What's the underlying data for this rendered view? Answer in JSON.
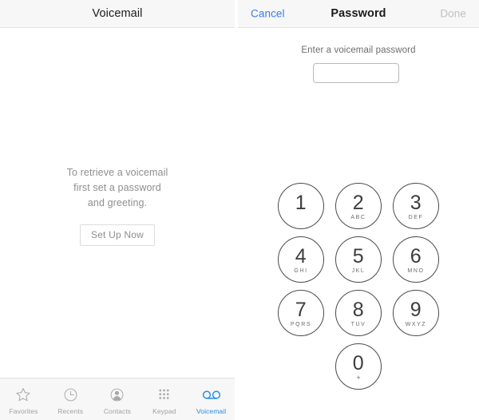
{
  "left_panel": {
    "navbar": {
      "title": "Voicemail"
    },
    "empty_state": {
      "lines": [
        "To retrieve a voicemail",
        "first set a password",
        "and greeting."
      ],
      "button_label": "Set Up Now"
    },
    "tabbar": {
      "items": [
        {
          "label": "Favorites",
          "icon": "star-icon",
          "active": false
        },
        {
          "label": "Recents",
          "icon": "clock-icon",
          "active": false
        },
        {
          "label": "Contacts",
          "icon": "person-icon",
          "active": false
        },
        {
          "label": "Keypad",
          "icon": "keypad-dots-icon",
          "active": false
        },
        {
          "label": "Voicemail",
          "icon": "voicemail-reels-icon",
          "active": true
        }
      ],
      "active_color": "#1b8fe8",
      "inactive_color": "#a0a0a5"
    }
  },
  "right_panel": {
    "navbar": {
      "cancel_label": "Cancel",
      "title": "Password",
      "done_label": "Done",
      "cancel_color": "#3a7cf0",
      "done_color": "#c0c0c0"
    },
    "password_form": {
      "label": "Enter a voicemail password",
      "value": "",
      "placeholder": ""
    },
    "keypad": {
      "rows": [
        [
          {
            "digit": "1",
            "letters": ""
          },
          {
            "digit": "2",
            "letters": "ABC"
          },
          {
            "digit": "3",
            "letters": "DEF"
          }
        ],
        [
          {
            "digit": "4",
            "letters": "GHI"
          },
          {
            "digit": "5",
            "letters": "JKL"
          },
          {
            "digit": "6",
            "letters": "MNO"
          }
        ],
        [
          {
            "digit": "7",
            "letters": "PQRS"
          },
          {
            "digit": "8",
            "letters": "TUV"
          },
          {
            "digit": "9",
            "letters": "WXYZ"
          }
        ],
        [
          {
            "digit": "0",
            "letters": "+"
          }
        ]
      ]
    }
  }
}
